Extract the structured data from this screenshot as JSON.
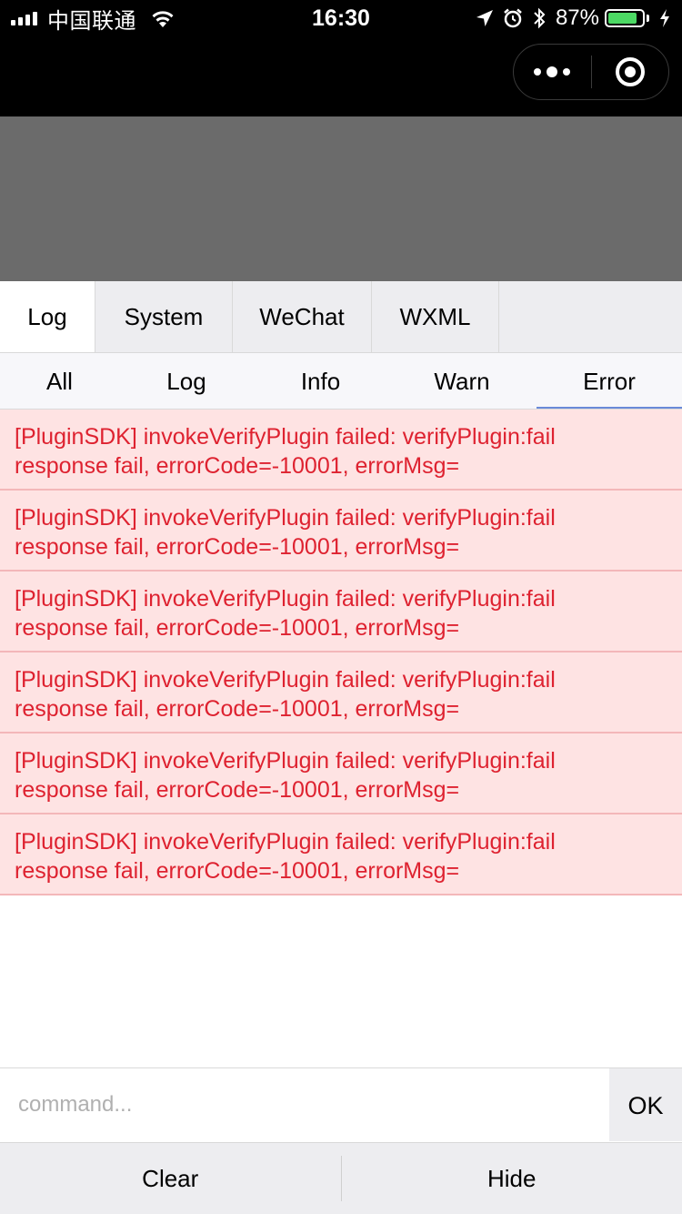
{
  "status_bar": {
    "carrier": "中国联通",
    "time": "16:30",
    "battery_percent": "87%",
    "battery_level": 0.87,
    "battery_color": "#4cd964",
    "icons": [
      "signal-icon",
      "wifi-icon",
      "location-arrow-icon",
      "alarm-icon",
      "bluetooth-icon",
      "battery-icon",
      "charging-bolt-icon"
    ]
  },
  "nav_bar": {
    "capsule_icons": [
      "more-dots-icon",
      "close-target-icon"
    ]
  },
  "top_tabs": [
    {
      "label": "Log",
      "active": true
    },
    {
      "label": "System",
      "active": false
    },
    {
      "label": "WeChat",
      "active": false
    },
    {
      "label": "WXML",
      "active": false
    }
  ],
  "sub_tabs": [
    {
      "label": "All",
      "active": false
    },
    {
      "label": "Log",
      "active": false
    },
    {
      "label": "Info",
      "active": false
    },
    {
      "label": "Warn",
      "active": false
    },
    {
      "label": "Error",
      "active": true
    }
  ],
  "logs": [
    {
      "line1": "[PluginSDK] invokeVerifyPlugin failed: verifyPlugin:fail",
      "line2": "response fail, errorCode=-10001, errorMsg="
    },
    {
      "line1": "[PluginSDK] invokeVerifyPlugin failed: verifyPlugin:fail",
      "line2": "response fail, errorCode=-10001, errorMsg="
    },
    {
      "line1": "[PluginSDK] invokeVerifyPlugin failed: verifyPlugin:fail",
      "line2": "response fail, errorCode=-10001, errorMsg="
    },
    {
      "line1": "[PluginSDK] invokeVerifyPlugin failed: verifyPlugin:fail",
      "line2": "response fail, errorCode=-10001, errorMsg="
    },
    {
      "line1": "[PluginSDK] invokeVerifyPlugin failed: verifyPlugin:fail",
      "line2": "response fail, errorCode=-10001, errorMsg="
    },
    {
      "line1": "[PluginSDK] invokeVerifyPlugin failed: verifyPlugin:fail",
      "line2": "response fail, errorCode=-10001, errorMsg="
    }
  ],
  "command": {
    "value": "",
    "placeholder": "command...",
    "ok_label": "OK"
  },
  "bottom": {
    "clear_label": "Clear",
    "hide_label": "Hide"
  },
  "colors": {
    "error_text": "#de2230",
    "error_bg": "#fee3e3",
    "error_border": "#f3b7b9",
    "active_underline": "#6a8ad8",
    "backdrop": "#6b6b6b"
  }
}
